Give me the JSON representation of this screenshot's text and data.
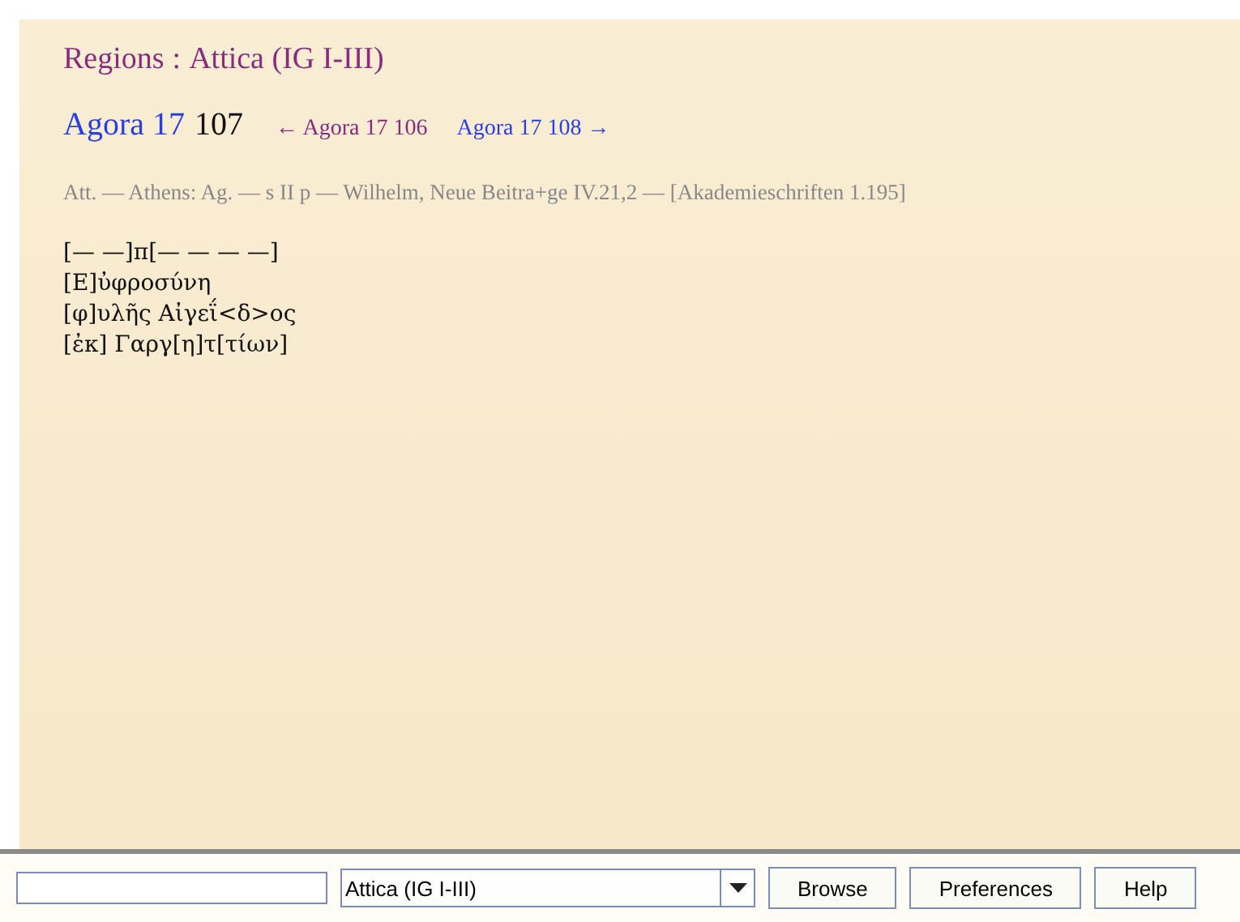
{
  "breadcrumb": {
    "label": "Regions",
    "separator": ":",
    "region": "Attica (IG I-III)"
  },
  "heading": {
    "volume": "Agora 17",
    "number": "107"
  },
  "nav": [
    {
      "text": "← Agora 17 106",
      "visited": true
    },
    {
      "text": "Agora 17 108 →",
      "visited": false
    }
  ],
  "metadata": "Att. — Athens: Ag. — s II p — Wilhelm, Neue Beitra+ge IV.21,2 — [Akademieschriften 1.195]",
  "inscription_lines": [
    "[— —]π[— — — —]",
    "[Ε]ὐφροσύνη",
    "[φ]υλῆς Αἰγεΐ<δ>ος",
    "[ἐκ] Γαργ[η]τ[τίων]"
  ],
  "toolbar": {
    "region_select": {
      "value": "Attica (IG I-III)"
    },
    "buttons": [
      "Browse",
      "Preferences",
      "Help"
    ]
  }
}
